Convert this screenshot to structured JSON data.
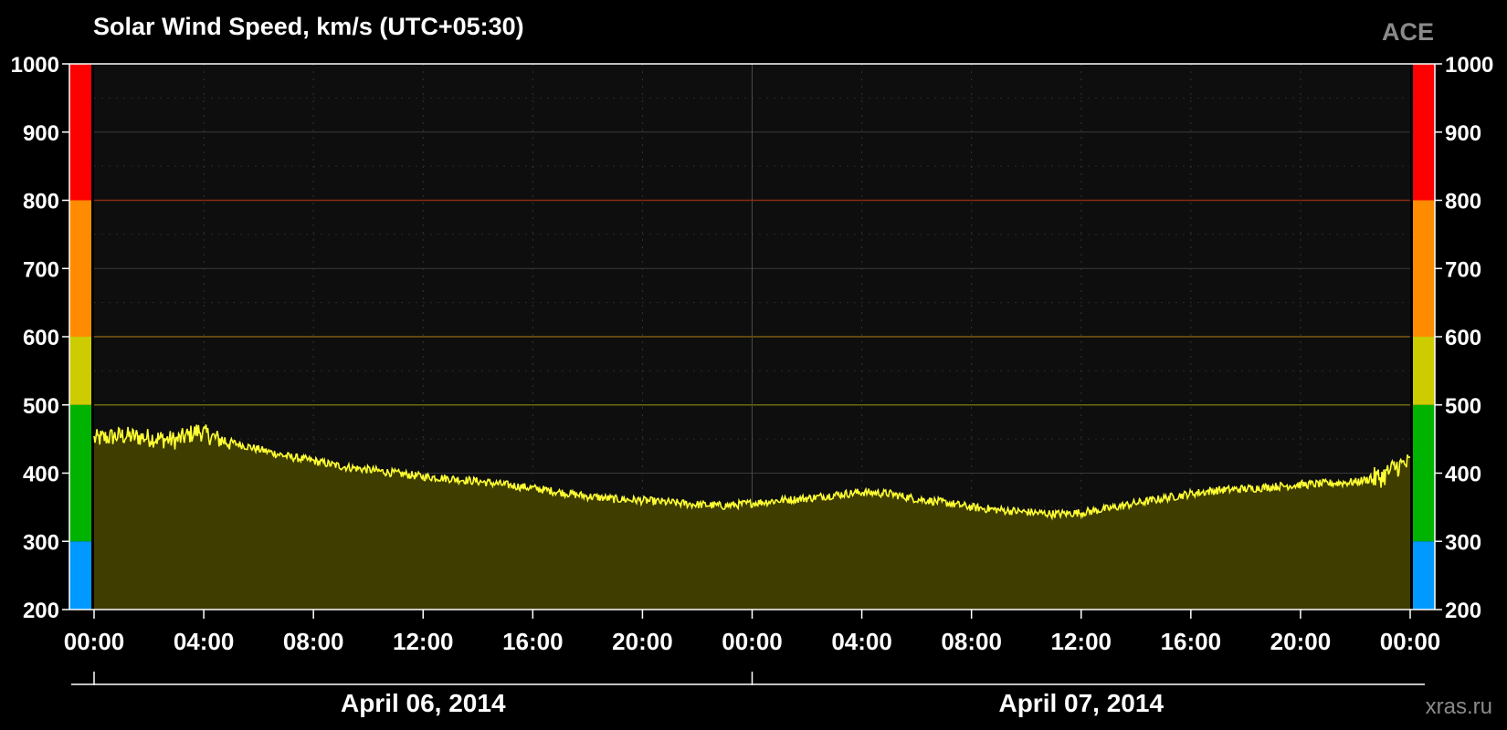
{
  "chart_data": {
    "type": "area",
    "title": "Solar Wind Speed, km/s (UTC+05:30)",
    "source_label": "ACE",
    "credit": "xras.ru",
    "ylim": [
      200,
      1000
    ],
    "yticks": [
      200,
      300,
      400,
      500,
      600,
      700,
      800,
      900,
      1000
    ],
    "xlim_hours": [
      0,
      48
    ],
    "xtick_labels": [
      "00:00",
      "04:00",
      "08:00",
      "12:00",
      "16:00",
      "20:00",
      "00:00",
      "04:00",
      "08:00",
      "12:00",
      "16:00",
      "20:00",
      "00:00"
    ],
    "dates": [
      {
        "label": "April 06, 2014",
        "start_hour": 0,
        "end_hour": 24
      },
      {
        "label": "April 07, 2014",
        "start_hour": 24,
        "end_hour": 48
      }
    ],
    "grid": true,
    "speed_bands": [
      {
        "from": 200,
        "to": 300,
        "color": "#0099ff"
      },
      {
        "from": 300,
        "to": 500,
        "color": "#00b300"
      },
      {
        "from": 500,
        "to": 600,
        "color": "#cccc00"
      },
      {
        "from": 600,
        "to": 800,
        "color": "#ff8c00"
      },
      {
        "from": 800,
        "to": 1000,
        "color": "#ff0000"
      }
    ],
    "threshold_lines": [
      {
        "value": 500,
        "color": "#6b6b10"
      },
      {
        "value": 600,
        "color": "#7a5a10"
      },
      {
        "value": 800,
        "color": "#8a2a10"
      }
    ],
    "series": [
      {
        "line_color": "#ffff33",
        "fill_color": "#3f3d00",
        "x_hours": [
          0,
          1,
          2,
          3,
          3.8,
          4.5,
          5,
          6,
          7,
          8,
          9,
          10,
          11,
          12,
          13,
          14,
          15,
          16,
          17,
          18,
          19,
          20,
          21,
          22,
          23,
          24,
          25,
          26,
          27,
          28,
          29,
          30,
          31,
          32,
          33,
          34,
          35,
          36,
          37,
          38,
          39,
          40,
          41,
          42,
          43,
          44,
          45,
          46,
          47,
          47.5,
          48
        ],
        "values": [
          450,
          455,
          452,
          448,
          462,
          450,
          445,
          435,
          425,
          418,
          410,
          405,
          400,
          395,
          392,
          388,
          383,
          378,
          372,
          366,
          362,
          360,
          357,
          354,
          352,
          356,
          360,
          363,
          368,
          372,
          370,
          362,
          357,
          350,
          346,
          343,
          340,
          342,
          348,
          356,
          363,
          370,
          375,
          377,
          380,
          383,
          385,
          387,
          395,
          410,
          415
        ]
      }
    ]
  }
}
